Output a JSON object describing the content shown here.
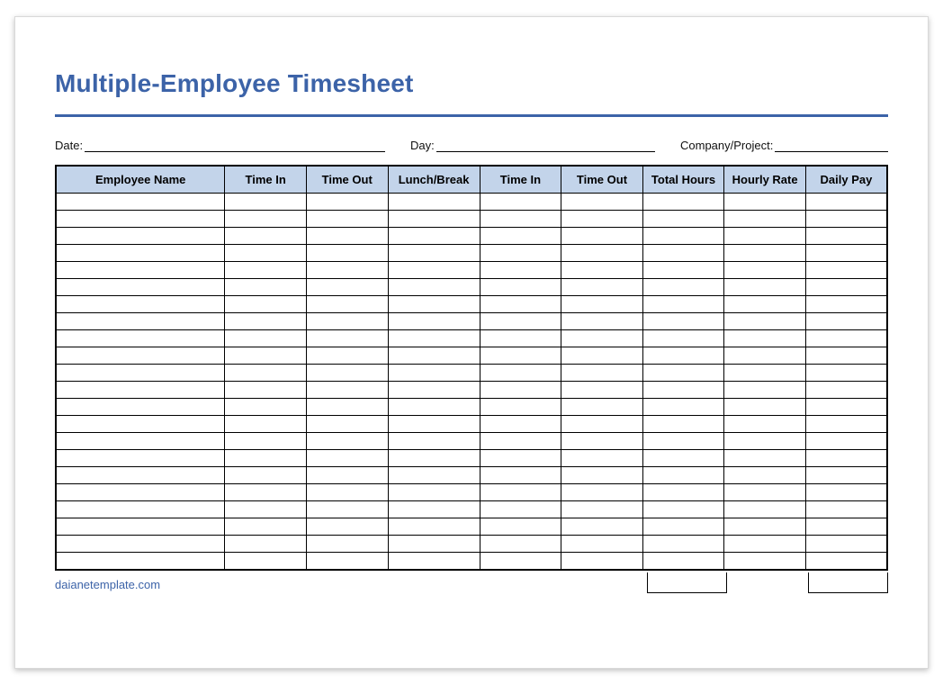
{
  "title": "Multiple-Employee Timesheet",
  "meta": {
    "date_label": "Date:",
    "date_value": "",
    "day_label": "Day:",
    "day_value": "",
    "company_label": "Company/Project:",
    "company_value": ""
  },
  "columns": [
    "Employee Name",
    "Time In",
    "Time Out",
    "Lunch/Break",
    "Time In",
    "Time Out",
    "Total Hours",
    "Hourly Rate",
    "Daily Pay"
  ],
  "row_count": 22,
  "totals": {
    "total_hours": "",
    "daily_pay": ""
  },
  "footer": {
    "source": "daianetemplate.com"
  },
  "colors": {
    "accent": "#3c63a8",
    "header_bg": "#c3d4ea"
  }
}
